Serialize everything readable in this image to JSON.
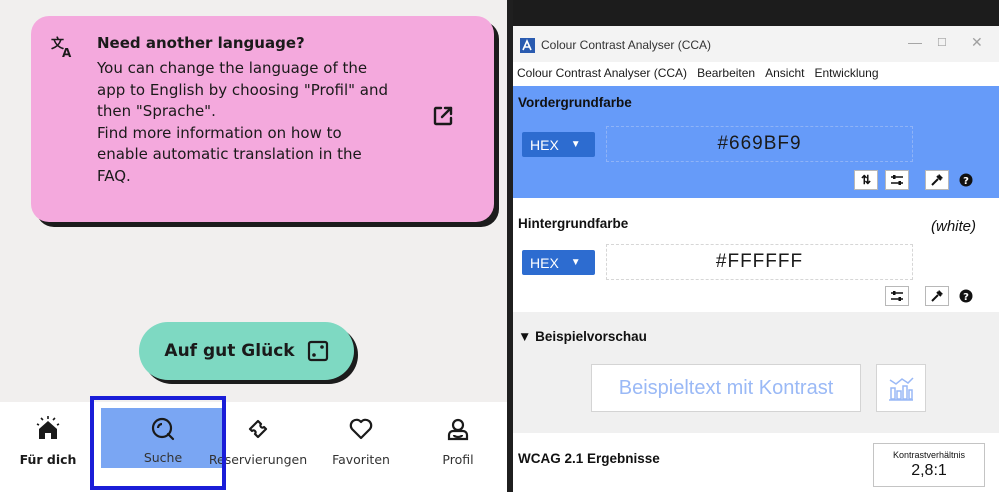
{
  "app": {
    "info_card": {
      "title": "Need another language?",
      "body_lines": [
        "You can change the language of the",
        "app to English by choosing \"Profil\" and",
        "then \"Sprache\".",
        "Find more information on how to",
        "enable automatic translation in the",
        "FAQ."
      ],
      "color": "#f4a9dd"
    },
    "lucky_button": {
      "label": "Auf gut Glück",
      "color": "#7ed9c2"
    },
    "tabs": [
      {
        "label": "Für dich",
        "icon": "home-icon"
      },
      {
        "label": "Suche",
        "icon": "search-icon",
        "active": true
      },
      {
        "label": "Reservierungen",
        "icon": "ticket-icon"
      },
      {
        "label": "Favoriten",
        "icon": "heart-icon"
      },
      {
        "label": "Profil",
        "icon": "profile-icon"
      }
    ],
    "active_tab_color": "#7aa6f3",
    "focus_color": "#1a1dd8"
  },
  "cca": {
    "window_title": "Colour Contrast Analyser (CCA)",
    "menu": [
      "Colour Contrast Analyser (CCA)",
      "Bearbeiten",
      "Ansicht",
      "Entwicklung"
    ],
    "foreground": {
      "label": "Vordergrundfarbe",
      "format": "HEX",
      "value": "#669BF9",
      "color": "#669bf9"
    },
    "background": {
      "label": "Hintergrundfarbe",
      "format": "HEX",
      "value": "#FFFFFF",
      "name": "(white)"
    },
    "preview": {
      "label": "▼ Beispielvorschau",
      "text": "Beispieltext mit Kontrast"
    },
    "wcag": {
      "label": "WCAG 2.1 Ergebnisse",
      "ratio_label": "Kontrastverhältnis",
      "ratio_value": "2,8:1"
    },
    "window_controls": {
      "minimize": "—",
      "maximize": "☐",
      "close": "✕"
    }
  }
}
